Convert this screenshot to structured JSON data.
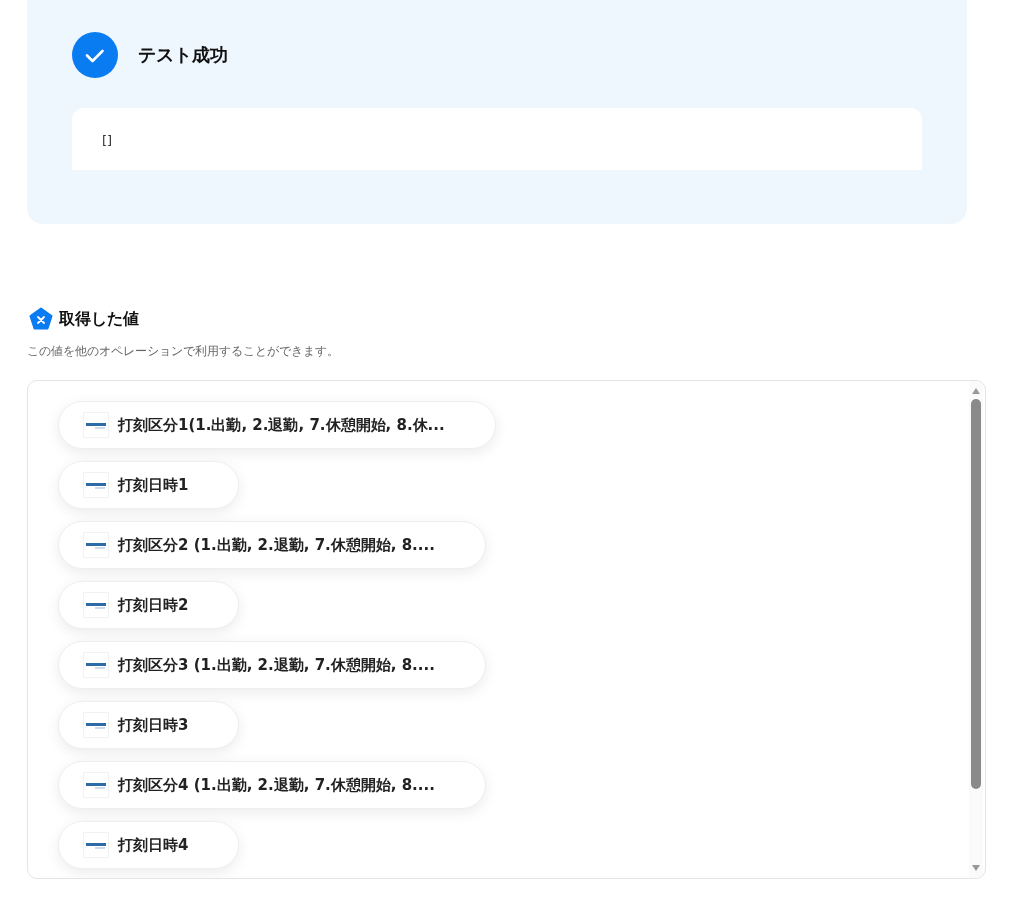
{
  "result": {
    "success": true,
    "title": "テスト成功",
    "output": "[]"
  },
  "values_section": {
    "title": "取得した値",
    "description": "この値を他のオペレーションで利用することができます。",
    "items": [
      {
        "label": "打刻区分1(1.出勤, 2.退勤, 7.休憩開始, 8.休..."
      },
      {
        "label": "打刻日時1"
      },
      {
        "label": "打刻区分2 (1.出勤, 2.退勤, 7.休憩開始, 8...."
      },
      {
        "label": "打刻日時2"
      },
      {
        "label": "打刻区分3 (1.出勤, 2.退勤, 7.休憩開始, 8...."
      },
      {
        "label": "打刻日時3"
      },
      {
        "label": "打刻区分4 (1.出勤, 2.退勤, 7.休憩開始, 8...."
      },
      {
        "label": "打刻日時4"
      }
    ]
  }
}
